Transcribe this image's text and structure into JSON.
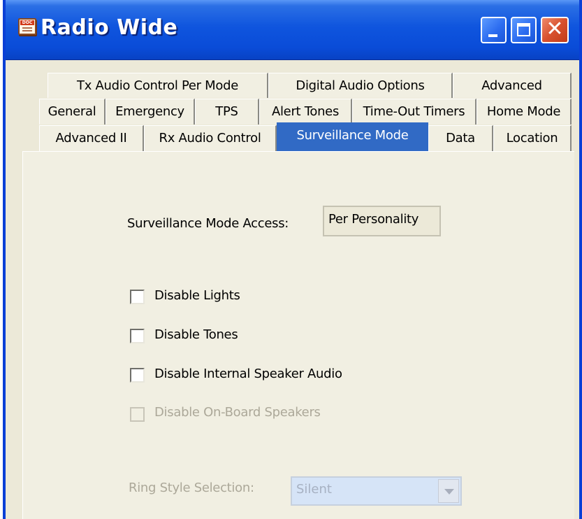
{
  "window": {
    "title": "Radio Wide",
    "app_icon_text": "DOC"
  },
  "tabs": {
    "row1": [
      "Tx Audio Control Per Mode",
      "Digital Audio Options",
      "Advanced"
    ],
    "row2": [
      "General",
      "Emergency",
      "TPS",
      "Alert Tones",
      "Time-Out Timers",
      "Home Mode"
    ],
    "row3": [
      "Advanced II",
      "Rx Audio Control",
      "Surveillance Mode",
      "Data",
      "Location"
    ],
    "active": "Surveillance Mode"
  },
  "surveillance": {
    "access_label": "Surveillance Mode Access:",
    "access_value": "Per Personality",
    "checkboxes": [
      {
        "label": "Disable Lights",
        "checked": false,
        "enabled": true
      },
      {
        "label": "Disable Tones",
        "checked": false,
        "enabled": true
      },
      {
        "label": "Disable Internal Speaker Audio",
        "checked": false,
        "enabled": true
      },
      {
        "label": "Disable On-Board Speakers",
        "checked": false,
        "enabled": false
      }
    ],
    "ring_label": "Ring Style Selection:",
    "ring_value": "Silent",
    "ring_enabled": false
  }
}
